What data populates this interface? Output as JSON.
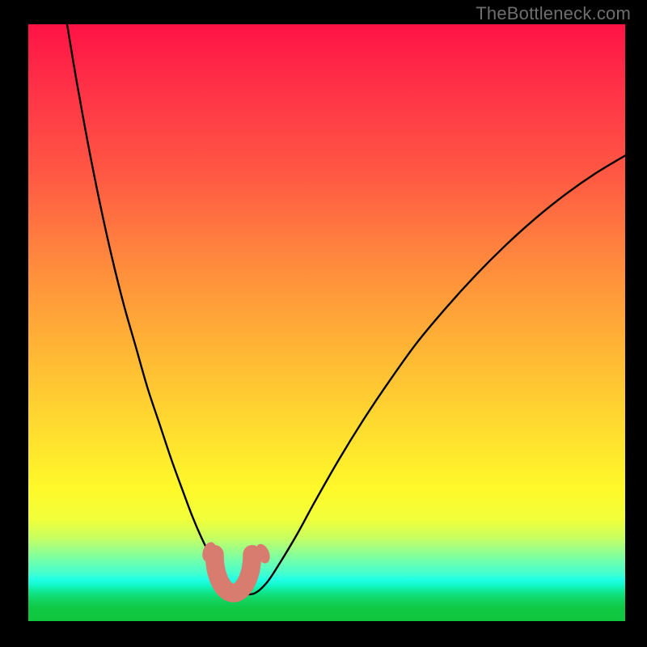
{
  "watermark": "TheBottleneck.com",
  "chart_data": {
    "type": "line",
    "title": "",
    "xlabel": "",
    "ylabel": "",
    "xlim": [
      0,
      100
    ],
    "ylim": [
      0,
      100
    ],
    "gradient_stops": [
      {
        "pct": 0,
        "color": "#ff1345"
      },
      {
        "pct": 8,
        "color": "#ff2a47"
      },
      {
        "pct": 25,
        "color": "#ff5844"
      },
      {
        "pct": 40,
        "color": "#ff8a3d"
      },
      {
        "pct": 55,
        "color": "#ffb735"
      },
      {
        "pct": 68,
        "color": "#ffdd2f"
      },
      {
        "pct": 78,
        "color": "#fff92a"
      },
      {
        "pct": 83,
        "color": "#f0ff3a"
      },
      {
        "pct": 86,
        "color": "#c8ff60"
      },
      {
        "pct": 88,
        "color": "#9cff88"
      },
      {
        "pct": 90,
        "color": "#6fffae"
      },
      {
        "pct": 92,
        "color": "#44ffce"
      },
      {
        "pct": 93,
        "color": "#22ffe6"
      },
      {
        "pct": 94,
        "color": "#12f7c8"
      },
      {
        "pct": 95,
        "color": "#10e893"
      },
      {
        "pct": 96,
        "color": "#10da6c"
      },
      {
        "pct": 97,
        "color": "#10cf53"
      },
      {
        "pct": 98,
        "color": "#10c843"
      },
      {
        "pct": 100,
        "color": "#10c63e"
      }
    ],
    "series": [
      {
        "name": "curve",
        "color": "#000000",
        "x": [
          6.5,
          8,
          10,
          12,
          14,
          16,
          18,
          20,
          22,
          24,
          26,
          27.5,
          29,
          30.5,
          32,
          33,
          34,
          35,
          36,
          38,
          40,
          42,
          45,
          48,
          52,
          56,
          60,
          65,
          70,
          75,
          80,
          85,
          90,
          95,
          100
        ],
        "y": [
          100,
          91,
          80,
          70,
          61,
          53,
          46,
          39,
          33,
          27,
          21.5,
          17.5,
          14,
          11,
          8.5,
          7,
          5.8,
          5,
          4.5,
          4.7,
          6.5,
          9.5,
          14.5,
          20,
          27,
          33.5,
          39.5,
          46.5,
          52.5,
          58,
          63,
          67.5,
          71.5,
          75,
          78
        ]
      }
    ],
    "markers": [
      {
        "name": "dot-left-upper",
        "x": 30.3,
        "y": 11.6,
        "shape": "ellipse",
        "w": 2.1,
        "h": 3.4,
        "rot": 18,
        "color": "#d87c6f"
      },
      {
        "name": "dot-right-upper",
        "x": 39.3,
        "y": 11.3,
        "shape": "ellipse",
        "w": 2.1,
        "h": 3.4,
        "rot": -22,
        "color": "#d87c6f"
      },
      {
        "name": "arc-bottom",
        "shape": "u-arc",
        "x0": 31.2,
        "y0": 11.2,
        "x1": 37.5,
        "y1": 11.2,
        "depth": 6.5,
        "width": 3.1,
        "color": "#d87c6f"
      }
    ]
  }
}
